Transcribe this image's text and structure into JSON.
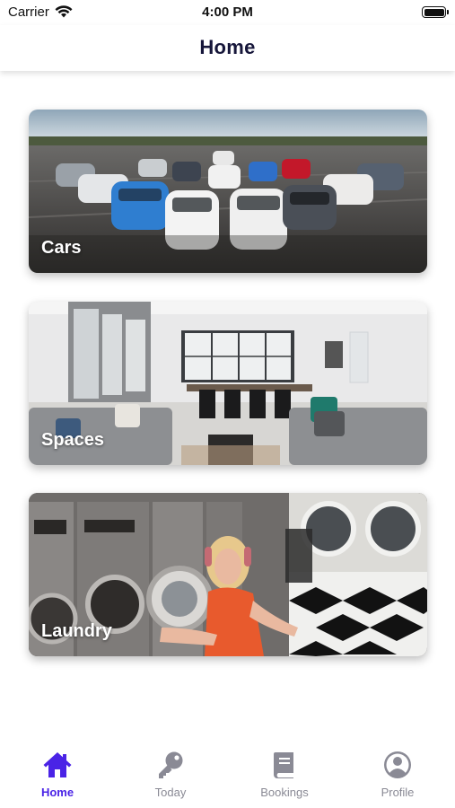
{
  "status_bar": {
    "carrier": "Carrier",
    "time": "4:00 PM",
    "wifi_icon": "wifi-icon",
    "battery_icon": "battery-icon"
  },
  "header": {
    "title": "Home"
  },
  "cards": [
    {
      "label": "Cars",
      "image": "cars-photo"
    },
    {
      "label": "Spaces",
      "image": "spaces-photo"
    },
    {
      "label": "Laundry",
      "image": "laundry-photo"
    }
  ],
  "tabs": [
    {
      "label": "Home",
      "icon": "home-icon",
      "active": true
    },
    {
      "label": "Today",
      "icon": "key-icon",
      "active": false
    },
    {
      "label": "Bookings",
      "icon": "book-icon",
      "active": false
    },
    {
      "label": "Profile",
      "icon": "user-circle-icon",
      "active": false
    }
  ],
  "colors": {
    "accent": "#4a23e6",
    "inactive": "#8a8a95",
    "title": "#16163a"
  }
}
